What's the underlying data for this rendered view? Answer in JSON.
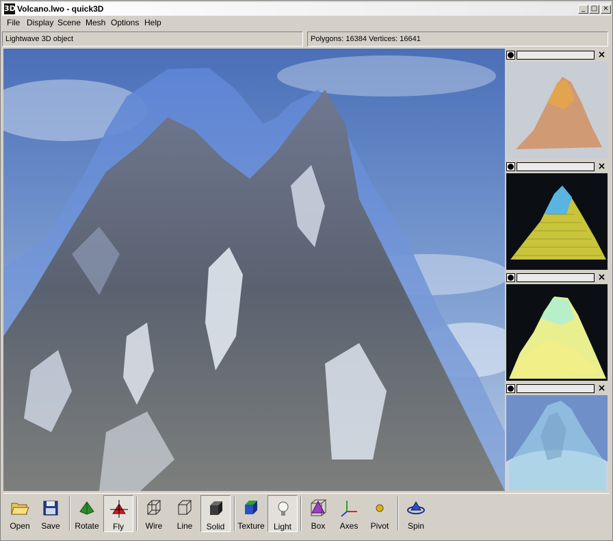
{
  "window": {
    "app_icon": "3D",
    "title": "Volcano.lwo - quick3D",
    "controls": [
      "_",
      "□",
      "×"
    ]
  },
  "menu": [
    "File",
    "Display",
    "Scene",
    "Mesh",
    "Options",
    "Help"
  ],
  "status": {
    "left": "Lightwave 3D object",
    "right": "Polygons: 16384  Vertices: 16641"
  },
  "side_panels": [
    {
      "close": "×",
      "style": "orange-shaded"
    },
    {
      "close": "×",
      "style": "yellow-wireframe"
    },
    {
      "close": "×",
      "style": "yellow-solid"
    },
    {
      "close": "×",
      "style": "transparent-blue"
    }
  ],
  "toolbar": {
    "open": "Open",
    "save": "Save",
    "rotate": "Rotate",
    "fly": "Fly",
    "wire": "Wire",
    "line": "Line",
    "solid": "Solid",
    "texture": "Texture",
    "light": "Light",
    "box": "Box",
    "axes": "Axes",
    "pivot": "Pivot",
    "spin": "Spin"
  },
  "colors": {
    "sky": "#5a7fc0",
    "mountain_front": "#6f7d93",
    "mountain_back": "#5f84d3",
    "window_bg": "#d4d0c8"
  }
}
